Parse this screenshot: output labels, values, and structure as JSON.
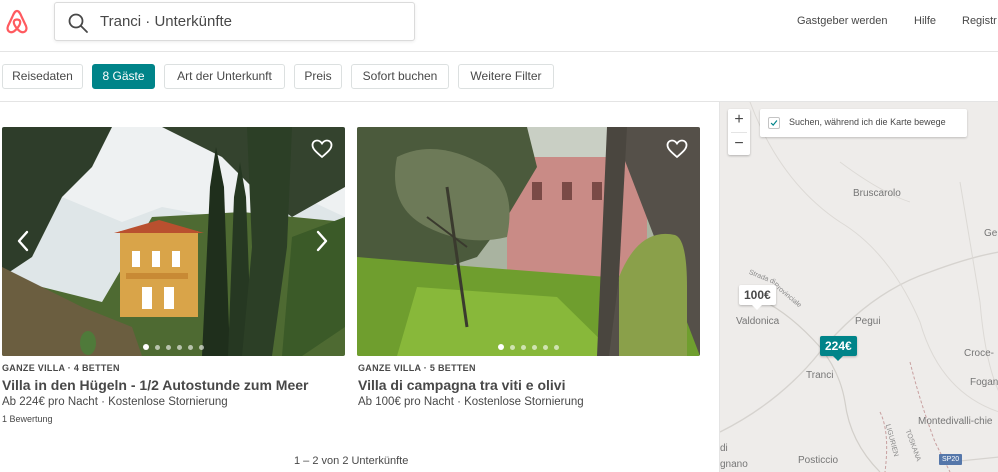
{
  "colors": {
    "accent": "#008489",
    "brand": "#ff5a5f",
    "text": "#484848"
  },
  "header": {
    "logo_icon": "airbnb-logo-icon",
    "search": {
      "icon": "search-icon",
      "value": "Tranci · Unterkünfte"
    },
    "nav": [
      "Gastgeber werden",
      "Hilfe",
      "Registr"
    ]
  },
  "filters": [
    {
      "label": "Reisedaten",
      "active": false
    },
    {
      "label": "8 Gäste",
      "active": true
    },
    {
      "label": "Art der Unterkunft",
      "active": false
    },
    {
      "label": "Preis",
      "active": false
    },
    {
      "label": "Sofort buchen",
      "active": false
    },
    {
      "label": "Weitere Filter",
      "active": false
    }
  ],
  "listings": [
    {
      "kind": "GANZE VILLA · 4 BETTEN",
      "title": "Villa in den Hügeln - 1/2 Autostunde zum Meer",
      "price": "Ab 224€  pro Nacht · Kostenlose Stornierung",
      "reviews": "1 Bewertung",
      "dots": 6,
      "active_dot": 0
    },
    {
      "kind": "GANZE VILLA · 5 BETTEN",
      "title": "Villa di campagna tra viti e olivi",
      "price": "Ab 100€  pro Nacht · Kostenlose Stornierung",
      "reviews": "",
      "dots": 6,
      "active_dot": 0
    }
  ],
  "pagination": "1 – 2 von 2 Unterkünfte",
  "map": {
    "zoom_in": "+",
    "zoom_out": "−",
    "search_while_moving": "Suchen, während ich die Karte bewege",
    "places": [
      "Bruscarolo",
      "Ge",
      "Valdonica",
      "Pegui",
      "Croce-",
      "Tranci",
      "Fogan",
      "Montedivalli-chie",
      "Posticcio",
      "gnano",
      "di"
    ],
    "roads": [
      "Strada di",
      "Provinciale",
      "LIGURIEN",
      "TOSKANA"
    ],
    "road_shield": "SP20",
    "pins": [
      {
        "label": "100€",
        "style": "white"
      },
      {
        "label": "224€",
        "style": "teal"
      }
    ]
  }
}
